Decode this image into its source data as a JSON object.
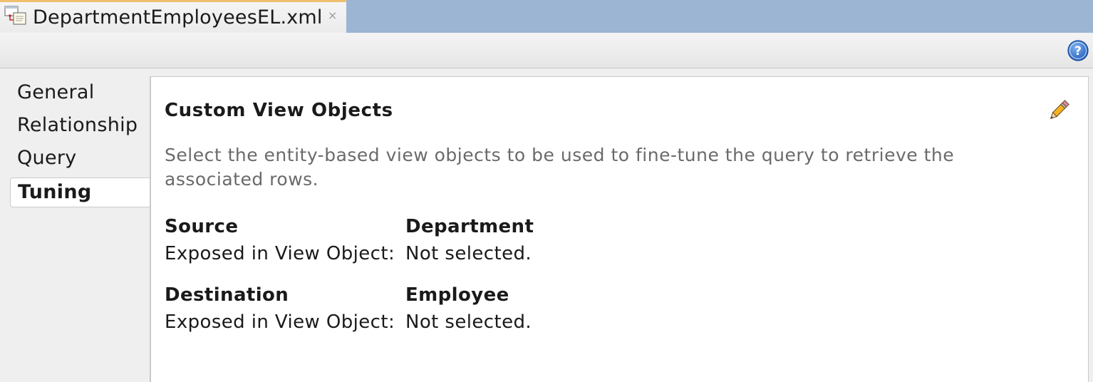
{
  "tab": {
    "title": "DepartmentEmployeesEL.xml",
    "close_glyph": "×",
    "icon": "xml-file-icon"
  },
  "toolbar": {
    "help_icon": "help-icon"
  },
  "sidebar": {
    "items": [
      {
        "label": "General",
        "selected": false
      },
      {
        "label": "Relationship",
        "selected": false
      },
      {
        "label": "Query",
        "selected": false
      },
      {
        "label": "Tuning",
        "selected": true
      }
    ]
  },
  "panel": {
    "title": "Custom View Objects",
    "description": "Select the entity-based view objects to be used to fine-tune the query to retrieve the associated rows.",
    "edit_icon": "pencil-icon",
    "source": {
      "heading": "Source",
      "entity": "Department",
      "exposed_label": "Exposed in View Object:",
      "exposed_value": "Not selected."
    },
    "destination": {
      "heading": "Destination",
      "entity": "Employee",
      "exposed_label": "Exposed in View Object:",
      "exposed_value": "Not selected."
    }
  },
  "colors": {
    "tabstrip_bg": "#9bb5d3",
    "tab_accent": "#f0c070",
    "help_blue": "#2a6fd0",
    "description_gray": "#6a6a6a"
  }
}
